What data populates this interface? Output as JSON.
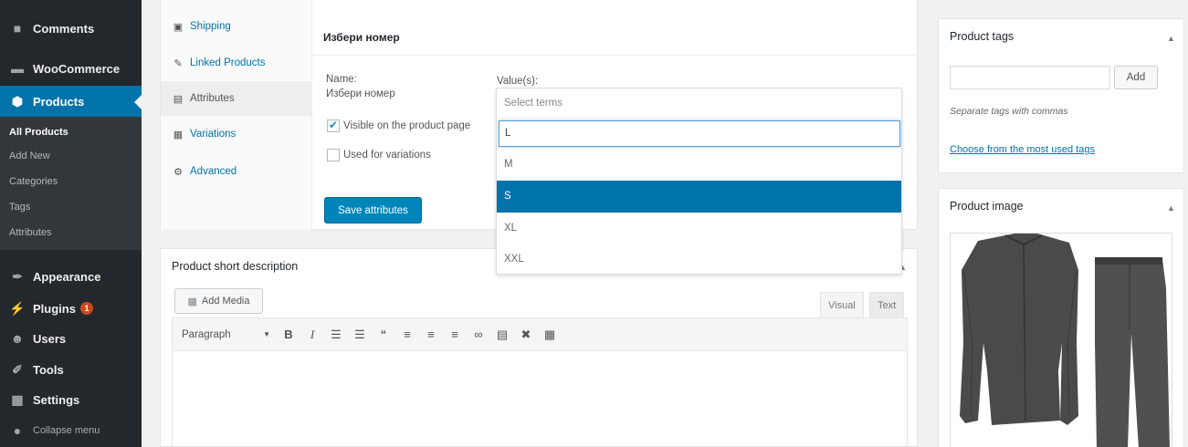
{
  "sidebar": {
    "top_items": [
      {
        "label": "Comments",
        "icon": "comment-icon"
      },
      {
        "label": "WooCommerce",
        "icon": "woocommerce-icon"
      },
      {
        "label": "Products",
        "icon": "products-icon"
      }
    ],
    "submenu": [
      "All Products",
      "Add New",
      "Categories",
      "Tags",
      "Attributes"
    ],
    "bottom_items": [
      {
        "label": "Appearance",
        "icon": "paintbrush-icon"
      },
      {
        "label": "Plugins",
        "icon": "plugin-icon",
        "badge": "1"
      },
      {
        "label": "Users",
        "icon": "users-icon"
      },
      {
        "label": "Tools",
        "icon": "wrench-icon"
      },
      {
        "label": "Settings",
        "icon": "settings-icon"
      },
      {
        "label": "Collapse menu",
        "icon": "collapse-icon"
      }
    ]
  },
  "product_data": {
    "tabs": [
      {
        "label": "Shipping",
        "icon": "truck-icon"
      },
      {
        "label": "Linked Products",
        "icon": "link-icon"
      },
      {
        "label": "Attributes",
        "icon": "attributes-icon"
      },
      {
        "label": "Variations",
        "icon": "grid-icon"
      },
      {
        "label": "Advanced",
        "icon": "gear-icon"
      }
    ],
    "attribute": {
      "title": "Избери номер",
      "name_label": "Name:",
      "name_value": "Избери номер",
      "values_label": "Value(s):",
      "visible_label": "Visible on the product page",
      "visible_checked": true,
      "variations_label": "Used for variations",
      "variations_checked": false
    },
    "save_label": "Save attributes"
  },
  "terms_select": {
    "placeholder": "Select terms",
    "search_value": "L",
    "options": [
      "M",
      "S",
      "XL",
      "XXL"
    ],
    "highlighted": "S"
  },
  "short_description": {
    "title": "Product short description",
    "add_media_label": "Add Media",
    "tab_visual": "Visual",
    "tab_text": "Text",
    "format_value": "Paragraph"
  },
  "tags_box": {
    "title": "Product tags",
    "add_label": "Add",
    "hint": "Separate tags with commas",
    "most_used_link": "Choose from the most used tags"
  },
  "image_box": {
    "title": "Product image"
  },
  "colors": {
    "admin_bg": "#23282d",
    "submenu_bg": "#32373c",
    "accent": "#0073aa",
    "button_primary": "#0085ba",
    "badge": "#ca4a1f"
  }
}
